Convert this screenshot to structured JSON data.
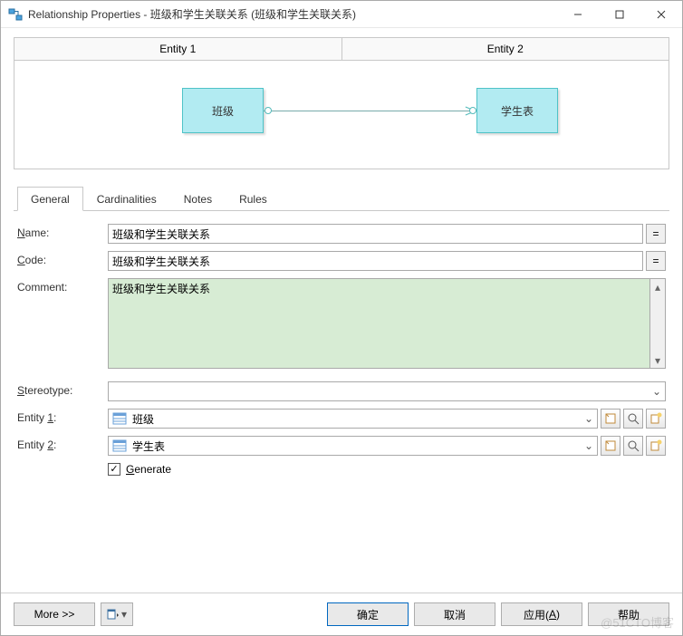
{
  "window": {
    "title": "Relationship Properties - 班级和学生关联关系 (班级和学生关联关系)"
  },
  "entity_headers": {
    "e1": "Entity 1",
    "e2": "Entity 2"
  },
  "diagram": {
    "left": "班级",
    "right": "学生表"
  },
  "tabs": {
    "general": "General",
    "cardinalities": "Cardinalities",
    "notes": "Notes",
    "rules": "Rules"
  },
  "fields": {
    "name": {
      "label": "Name:",
      "value": "班级和学生关联关系"
    },
    "code": {
      "label": "Code:",
      "value": "班级和学生关联关系"
    },
    "comment": {
      "label": "Comment:",
      "value": "班级和学生关联关系"
    },
    "stereotype": {
      "label": "Stereotype:",
      "value": ""
    },
    "entity1": {
      "label": "Entity 1:",
      "value": "班级"
    },
    "entity2": {
      "label": "Entity 2:",
      "value": "学生表"
    },
    "generate": {
      "label": "Generate",
      "checked": true
    },
    "eq": "="
  },
  "footer": {
    "more": "More >>",
    "ok": "确定",
    "cancel": "取消",
    "apply": "应用(A)",
    "help": "帮助"
  },
  "watermark": "@51CTO博客"
}
